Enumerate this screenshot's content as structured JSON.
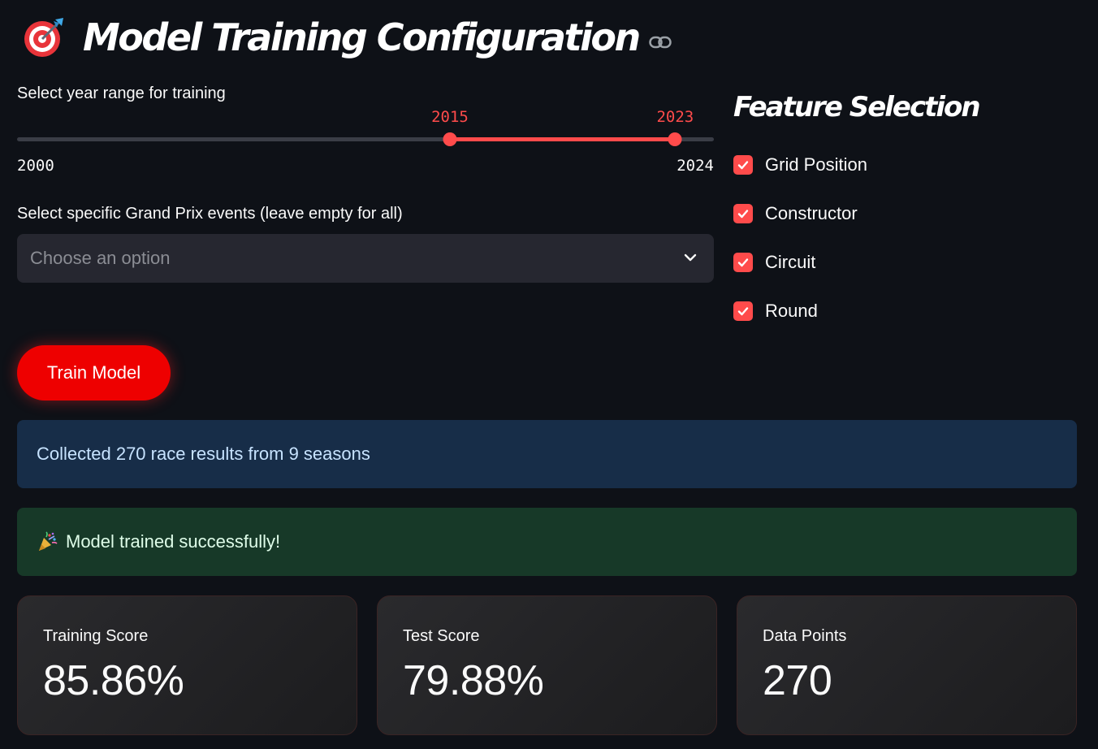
{
  "header": {
    "title": "Model Training Configuration",
    "icon": "target-dart-icon",
    "link_icon": "link-icon"
  },
  "year_slider": {
    "label": "Select year range for training",
    "min": 2000,
    "max": 2024,
    "selected_low": 2015,
    "selected_high": 2023,
    "min_label": "2000",
    "max_label": "2024",
    "low_label": "2015",
    "high_label": "2023",
    "accent_color": "#ff4b4b"
  },
  "events_select": {
    "label": "Select specific Grand Prix events (leave empty for all)",
    "placeholder": "Choose an option"
  },
  "feature_selection": {
    "title": "Feature Selection",
    "options": [
      {
        "label": "Grid Position",
        "checked": true
      },
      {
        "label": "Constructor",
        "checked": true
      },
      {
        "label": "Circuit",
        "checked": true
      },
      {
        "label": "Round",
        "checked": true
      }
    ]
  },
  "train_button": {
    "label": "Train Model",
    "color": "#ee0000"
  },
  "info_alert": {
    "text": "Collected 270 race results from 9 seasons"
  },
  "success_alert": {
    "icon": "party-popper-icon",
    "text": "Model trained successfully!"
  },
  "metrics": [
    {
      "label": "Training Score",
      "value": "85.86%"
    },
    {
      "label": "Test Score",
      "value": "79.88%"
    },
    {
      "label": "Data Points",
      "value": "270"
    }
  ]
}
